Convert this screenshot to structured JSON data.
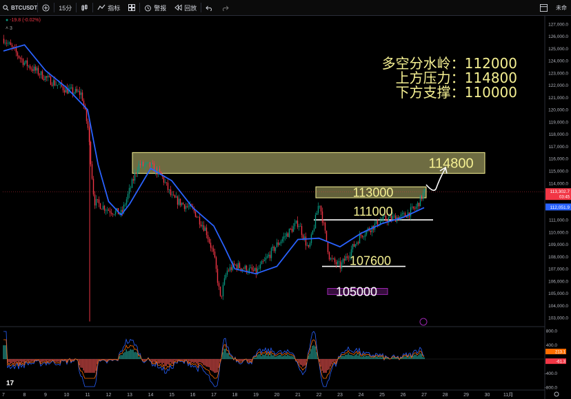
{
  "toolbar": {
    "symbol": "BTCUSDT",
    "interval": "15分",
    "indicators_label": "指标",
    "alerts_label": "警报",
    "replay_label": "回放",
    "right_label": "未命"
  },
  "legend": {
    "change": "-19.8 (-0.02%)",
    "count": "3"
  },
  "annotations": {
    "line1": "多空分水岭：112000",
    "line2": "上方压力：114800",
    "line3": "下方支撑：110000"
  },
  "levels": {
    "l114800": "114800",
    "l113000": "113000",
    "l111000": "111000",
    "l107600": "107600",
    "l105000": "105000"
  },
  "price_axis": {
    "ticks": [
      "127,000.0",
      "126,000.0",
      "125,000.0",
      "124,000.0",
      "123,000.0",
      "122,000.0",
      "121,000.0",
      "120,000.0",
      "119,000.0",
      "118,000.0",
      "117,000.0",
      "116,000.0",
      "115,000.0",
      "114,000.0",
      "113,000.0",
      "112,000.0",
      "111,000.0",
      "110,000.0",
      "109,000.0",
      "108,000.0",
      "107,000.0",
      "106,000.0",
      "105,000.0",
      "104,000.0",
      "103,000.0"
    ],
    "current_price": "113,302.7",
    "countdown": "03:45",
    "ma_price": "112,051.9"
  },
  "osc_axis": {
    "ticks": [
      "800.0",
      "400.0",
      "-400.0",
      "-800.0"
    ],
    "value1": "213.1",
    "value2": "-61.3"
  },
  "time_axis": [
    "7",
    "8",
    "9",
    "10",
    "11",
    "12",
    "13",
    "14",
    "15",
    "16",
    "17",
    "18",
    "19",
    "20",
    "21",
    "22",
    "23",
    "24",
    "25",
    "26",
    "27",
    "28",
    "29",
    "30",
    "11月"
  ],
  "colors": {
    "up": "#089981",
    "down": "#f23645",
    "ma": "#2962ff",
    "zone_yellow": "#f5f092",
    "zone_purple": "#9c27b0"
  },
  "chart_data": {
    "type": "candlestick",
    "symbol": "BTCUSDT",
    "interval": "15分",
    "ylim": [
      102500,
      127500
    ],
    "x_labels": [
      "7",
      "8",
      "9",
      "10",
      "11",
      "12",
      "13",
      "14",
      "15",
      "16",
      "17",
      "18",
      "19",
      "20",
      "21",
      "22",
      "23",
      "24",
      "25",
      "26",
      "27",
      "28",
      "29",
      "30",
      "11月"
    ],
    "price_path": [
      {
        "x": "7",
        "y": 125800
      },
      {
        "x": "8",
        "y": 123800
      },
      {
        "x": "9",
        "y": 122600
      },
      {
        "x": "10",
        "y": 121600
      },
      {
        "x": "10.7",
        "y": 121300
      },
      {
        "x": "11",
        "y": 118500
      },
      {
        "x": "11.3",
        "y": 112500
      },
      {
        "x": "12",
        "y": 111800
      },
      {
        "x": "12.6",
        "y": 111500
      },
      {
        "x": "13",
        "y": 113500
      },
      {
        "x": "13.4",
        "y": 115500
      },
      {
        "x": "14",
        "y": 115400
      },
      {
        "x": "14.5",
        "y": 114600
      },
      {
        "x": "15",
        "y": 112800
      },
      {
        "x": "16",
        "y": 111800
      },
      {
        "x": "16.6",
        "y": 110200
      },
      {
        "x": "17",
        "y": 108000
      },
      {
        "x": "17.3",
        "y": 104500
      },
      {
        "x": "17.6",
        "y": 106800
      },
      {
        "x": "18",
        "y": 107300
      },
      {
        "x": "19",
        "y": 106700
      },
      {
        "x": "20",
        "y": 109000
      },
      {
        "x": "21",
        "y": 110800
      },
      {
        "x": "21.5",
        "y": 108500
      },
      {
        "x": "22",
        "y": 112500
      },
      {
        "x": "22.5",
        "y": 107800
      },
      {
        "x": "23",
        "y": 107200
      },
      {
        "x": "23.5",
        "y": 108500
      },
      {
        "x": "24",
        "y": 109800
      },
      {
        "x": "25",
        "y": 111000
      },
      {
        "x": "26",
        "y": 111300
      },
      {
        "x": "26.6",
        "y": 112000
      },
      {
        "x": "27",
        "y": 113300
      }
    ],
    "moving_average": [
      {
        "x": "7",
        "y": 124800
      },
      {
        "x": "8",
        "y": 125300
      },
      {
        "x": "9",
        "y": 123200
      },
      {
        "x": "10",
        "y": 121800
      },
      {
        "x": "11",
        "y": 120000
      },
      {
        "x": "11.5",
        "y": 115500
      },
      {
        "x": "12",
        "y": 112500
      },
      {
        "x": "12.6",
        "y": 111400
      },
      {
        "x": "13",
        "y": 112300
      },
      {
        "x": "14",
        "y": 115200
      },
      {
        "x": "15",
        "y": 114200
      },
      {
        "x": "16",
        "y": 112000
      },
      {
        "x": "17",
        "y": 110500
      },
      {
        "x": "17.5",
        "y": 108800
      },
      {
        "x": "18",
        "y": 107000
      },
      {
        "x": "19",
        "y": 106600
      },
      {
        "x": "20",
        "y": 107200
      },
      {
        "x": "21",
        "y": 109400
      },
      {
        "x": "22",
        "y": 109500
      },
      {
        "x": "23",
        "y": 108800
      },
      {
        "x": "24",
        "y": 109900
      },
      {
        "x": "25",
        "y": 110700
      },
      {
        "x": "26",
        "y": 111200
      },
      {
        "x": "27",
        "y": 112000
      }
    ],
    "zones": [
      {
        "label": "114800",
        "from": 114800,
        "to": 116500
      },
      {
        "label": "113000",
        "from": 112800,
        "to": 113700
      },
      {
        "label": "105000",
        "from": 104900,
        "to": 105400
      }
    ],
    "lines": [
      {
        "label": "111000",
        "y": 111000
      },
      {
        "label": "107600",
        "y": 107200
      }
    ],
    "oscillator_ylim": [
      -800,
      800
    ]
  }
}
